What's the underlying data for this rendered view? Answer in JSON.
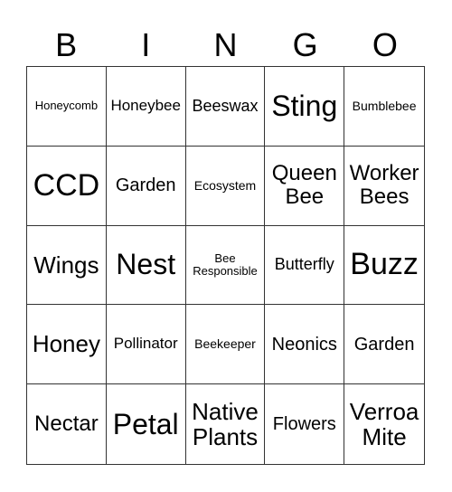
{
  "header": {
    "letters": [
      "B",
      "I",
      "N",
      "G",
      "O"
    ]
  },
  "cells": [
    "Honeycomb",
    "Honeybee",
    "Beeswax",
    "Sting",
    "Bumblebee",
    "CCD",
    "Garden",
    "Ecosystem",
    "Queen Bee",
    "Worker Bees",
    "Wings",
    "Nest",
    "Bee Responsible",
    "Butterfly",
    "Buzz",
    "Honey",
    "Pollinator",
    "Beekeeper",
    "Neonics",
    "Garden",
    "Nectar",
    "Petal",
    "Native Plants",
    "Flowers",
    "Verroa Mite"
  ]
}
